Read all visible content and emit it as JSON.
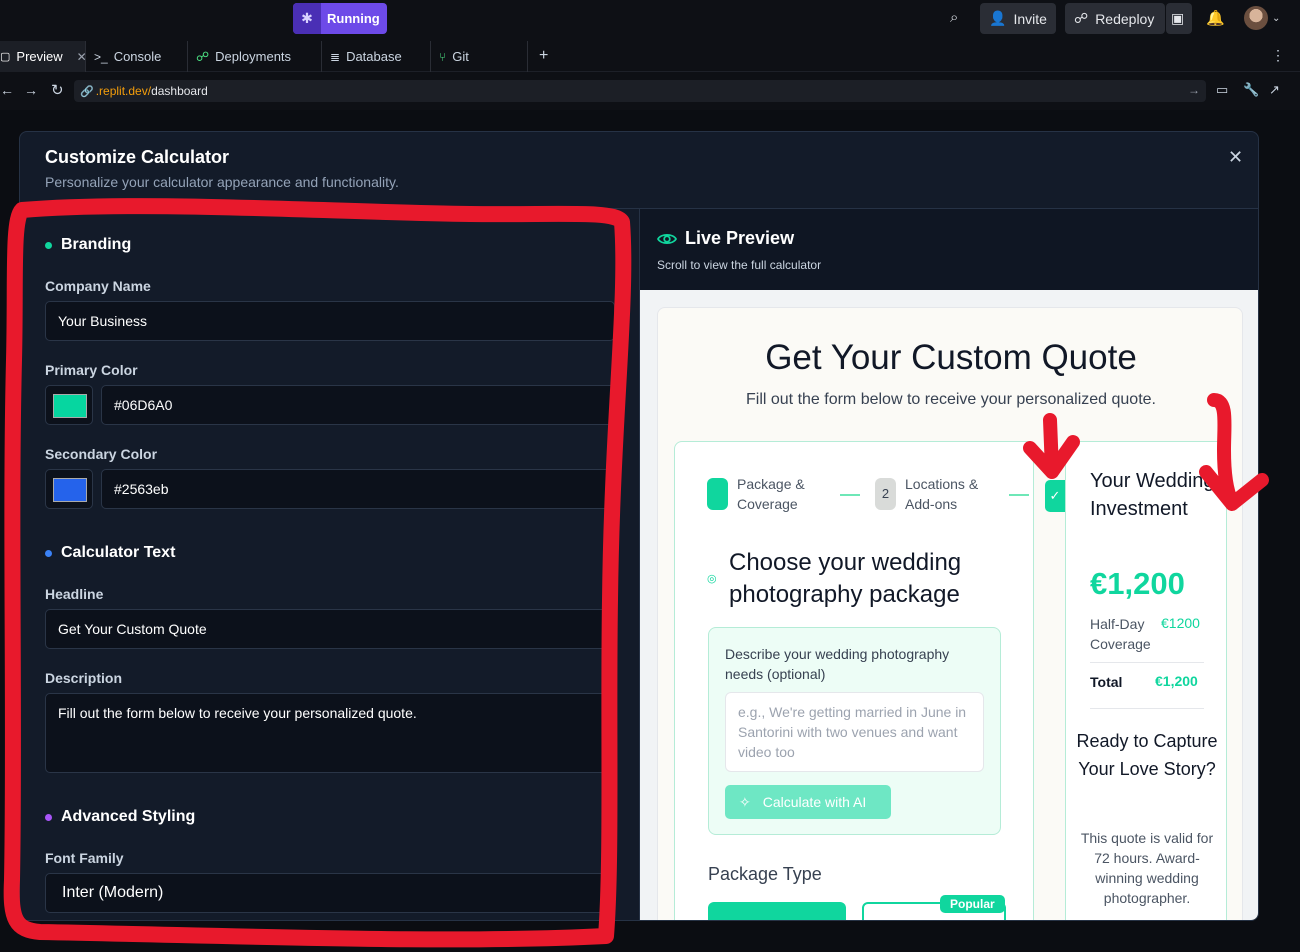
{
  "topbar": {
    "running_label": "Running",
    "invite_label": "Invite",
    "redeploy_label": "Redeploy"
  },
  "tabs": [
    {
      "label": "Preview"
    },
    {
      "label": "Console"
    },
    {
      "label": "Deployments"
    },
    {
      "label": "Database"
    },
    {
      "label": "Git"
    }
  ],
  "url": {
    "host": ".replit.dev/",
    "path": "dashboard"
  },
  "modal": {
    "title": "Customize Calculator",
    "subtitle": "Personalize your calculator appearance and functionality.",
    "close_glyph": "✕"
  },
  "branding": {
    "section_title": "Branding",
    "company_name_label": "Company Name",
    "company_name_value": "Your Business",
    "primary_color_label": "Primary Color",
    "primary_color_value": "#06D6A0",
    "secondary_color_label": "Secondary Color",
    "secondary_color_value": "#2563eb"
  },
  "calculator_text": {
    "section_title": "Calculator Text",
    "headline_label": "Headline",
    "headline_value": "Get Your Custom Quote",
    "description_label": "Description",
    "description_value": "Fill out the form below to receive your personalized quote."
  },
  "advanced_styling": {
    "section_title": "Advanced Styling",
    "font_family_label": "Font Family",
    "font_family_value": "Inter (Modern)"
  },
  "live_preview": {
    "title": "Live Preview",
    "subtitle": "Scroll to view the full calculator",
    "headline": "Get Your Custom Quote",
    "description": "Fill out the form below to receive your personalized quote.",
    "steps": [
      {
        "number": "",
        "label_line1": "Package &",
        "label_line2": "Coverage"
      },
      {
        "number": "2",
        "label_line1": "Locations &",
        "label_line2": "Add-ons"
      }
    ],
    "section_heading_line1": "Choose your wedding",
    "section_heading_line2": "photography package",
    "ai_label": "Describe your wedding photography needs (optional)",
    "ai_placeholder": "e.g., We're getting married in June in Santorini with two venues and want video too",
    "ai_button": "Calculate with AI",
    "package_type_label": "Package Type",
    "popular_badge": "Popular",
    "summary": {
      "title": "Your Wedding Investment",
      "total_big": "€1,200",
      "line_item_label": "Half-Day Coverage",
      "line_item_price": "€1200",
      "total_label": "Total",
      "total_value": "€1,200",
      "cta": "Ready to Capture Your Love Story?",
      "note": "This quote is valid for 72 hours. Award-winning wedding photographer."
    }
  },
  "colors": {
    "primary": "#06D6A0",
    "secondary": "#2563eb",
    "annotation": "#e8192c"
  }
}
